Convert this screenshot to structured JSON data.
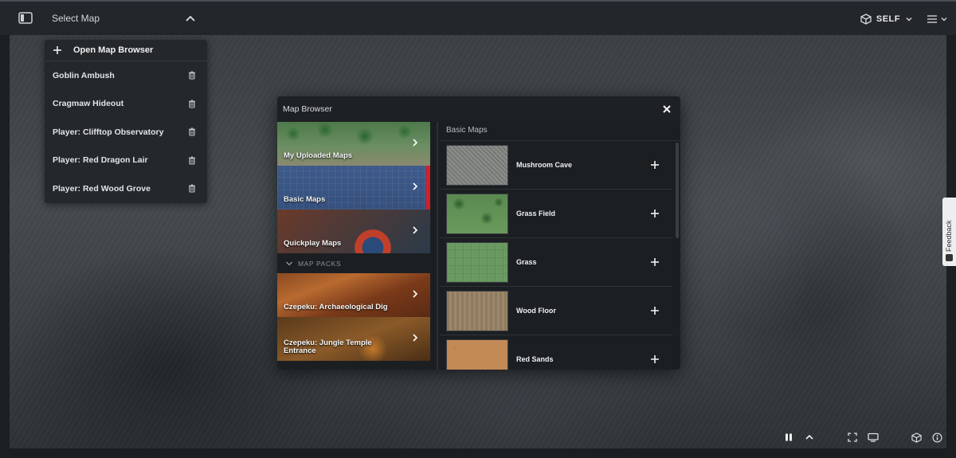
{
  "topbar": {
    "select_map_label": "Select Map",
    "self_label": "SELF"
  },
  "map_list": {
    "open_browser_label": "Open Map Browser",
    "items": [
      {
        "label": "Goblin Ambush"
      },
      {
        "label": "Cragmaw Hideout"
      },
      {
        "label": "Player: Clifftop Observatory"
      },
      {
        "label": "Player: Red Dragon Lair"
      },
      {
        "label": "Player: Red Wood Grove"
      }
    ]
  },
  "browser": {
    "title": "Map Browser",
    "categories": [
      {
        "label": "My Uploaded Maps"
      },
      {
        "label": "Basic Maps",
        "active": true
      },
      {
        "label": "Quickplay Maps"
      }
    ],
    "map_packs_label": "MAP PACKS",
    "packs": [
      {
        "label": "Czepeku: Archaeological Dig"
      },
      {
        "label": "Czepeku: Jungle Temple Entrance"
      }
    ],
    "section_title": "Basic Maps",
    "maps": [
      {
        "label": "Mushroom Cave"
      },
      {
        "label": "Grass Field"
      },
      {
        "label": "Grass"
      },
      {
        "label": "Wood Floor"
      },
      {
        "label": "Red Sands"
      }
    ]
  },
  "feedback": {
    "label": "Feedback"
  },
  "colors": {
    "accent": "#d1202a",
    "panel": "#1c1f22",
    "topbar": "#23262a"
  },
  "icons": {
    "sidebar_toggle": "sidebar-panel-icon",
    "select_map_chevron": "chevron-up-icon",
    "self_icon": "cube-icon",
    "menu": "hamburger-menu-icon",
    "add": "plus-icon",
    "delete": "trash-icon",
    "close": "close-icon",
    "category_arrow": "chevron-right-icon",
    "pause": "pause-icon",
    "fullscreen": "fullscreen-icon",
    "screen": "monitor-icon",
    "dice": "cube-icon",
    "info": "info-icon"
  }
}
